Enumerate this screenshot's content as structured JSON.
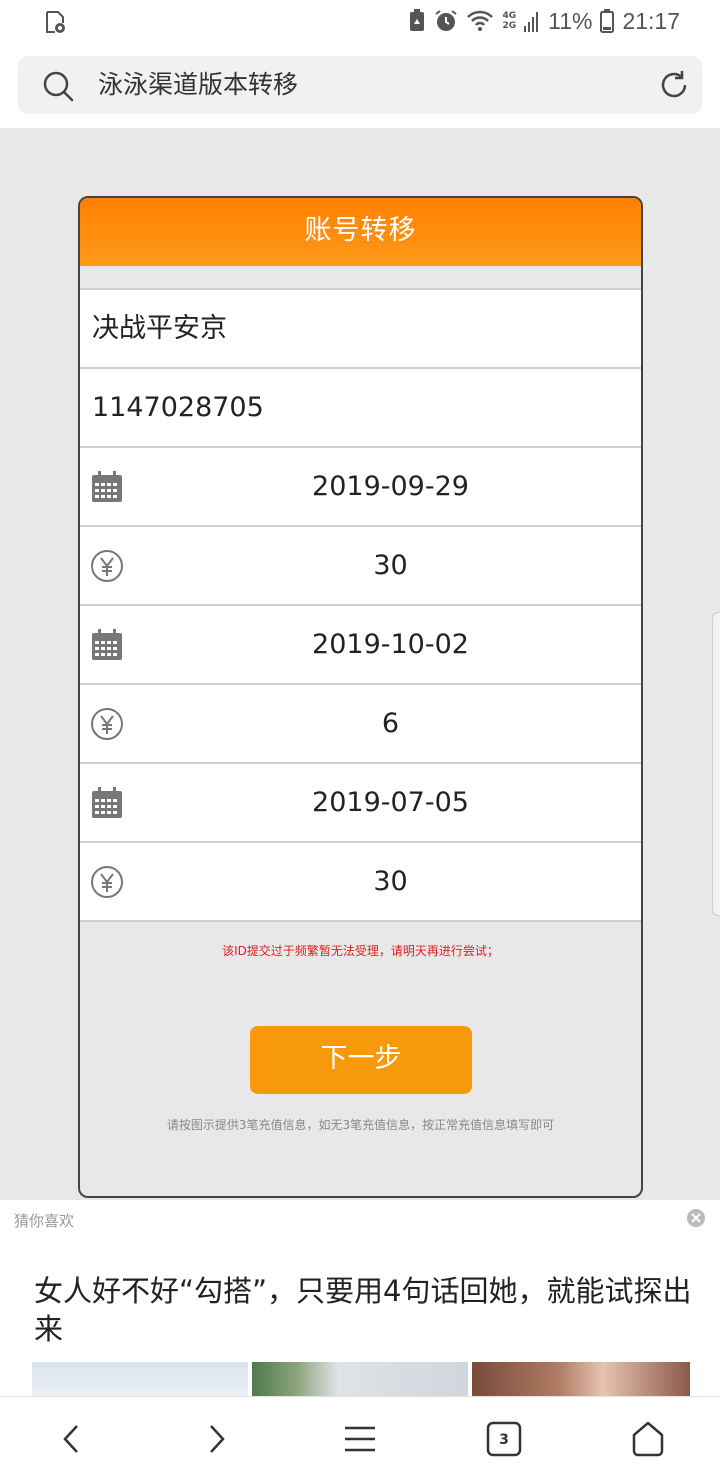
{
  "status_bar": {
    "battery": "11%",
    "time": "21:17",
    "network_top": "4G",
    "network_bottom": "2G"
  },
  "address_bar": {
    "text": "泳泳渠道版本转移"
  },
  "card": {
    "title": "账号转移",
    "server": "决战平安京",
    "account_id": "1147028705",
    "records": [
      {
        "date": "2019-09-29",
        "amount": "30"
      },
      {
        "date": "2019-10-02",
        "amount": "6"
      },
      {
        "date": "2019-07-05",
        "amount": "30"
      }
    ],
    "error": "该ID提交过于频繁暂无法受理，请明天再进行尝试；",
    "next_label": "下一步",
    "hint": "请按图示提供3笔充值信息，如无3笔充值信息，按正常充值信息填写即可"
  },
  "recommend": {
    "label": "猜你喜欢",
    "title": "女人好不好“勾搭”，只要用4句话回她，就能试探出来"
  },
  "bottom_nav": {
    "tab_count": "3"
  },
  "colors": {
    "accent": "#f8990b",
    "header_orange": "#ff7f00",
    "error": "#e02020"
  }
}
